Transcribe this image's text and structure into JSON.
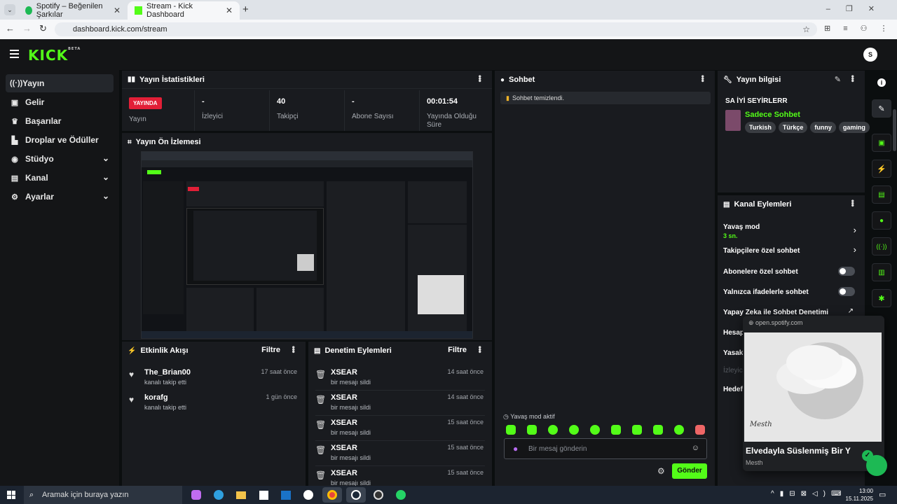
{
  "browser": {
    "tabs": [
      {
        "title": "Spotify – Beğenilen Şarkılar"
      },
      {
        "title": "Stream - Kick Dashboard"
      }
    ],
    "url": "dashboard.kick.com/stream"
  },
  "app": {
    "logo": "KICK",
    "logo_sup": "BETA",
    "avatar_initials": "S"
  },
  "sidebar": {
    "items": [
      {
        "label": "Yayın"
      },
      {
        "label": "Gelir"
      },
      {
        "label": "Başarılar"
      },
      {
        "label": "Droplar ve Ödüller"
      },
      {
        "label": "Stüdyo"
      },
      {
        "label": "Kanal"
      },
      {
        "label": "Ayarlar"
      }
    ]
  },
  "stats": {
    "title": "Yayın İstatistikleri",
    "live_badge": "YAYINDA",
    "items": [
      {
        "value": "",
        "label": "Yayın"
      },
      {
        "value": "-",
        "label": "İzleyici"
      },
      {
        "value": "40",
        "label": "Takipçi"
      },
      {
        "value": "-",
        "label": "Abone Sayısı"
      },
      {
        "value": "00:01:54",
        "label": "Yayında Olduğu Süre"
      }
    ]
  },
  "preview": {
    "title": "Yayın Ön İzlemesi"
  },
  "activity": {
    "title": "Etkinlik Akışı",
    "filter": "Filtre",
    "rows": [
      {
        "name": "The_Brian00",
        "sub": "kanalı takip etti",
        "time": "17 saat önce"
      },
      {
        "name": "korafg",
        "sub": "kanalı takip etti",
        "time": "1 gün önce"
      }
    ]
  },
  "moderation": {
    "title": "Denetim Eylemleri",
    "filter": "Filtre",
    "rows": [
      {
        "name": "XSEAR",
        "sub": "bir mesajı sildi",
        "time": "14 saat önce"
      },
      {
        "name": "XSEAR",
        "sub": "bir mesajı sildi",
        "time": "14 saat önce"
      },
      {
        "name": "XSEAR",
        "sub": "bir mesajı sildi",
        "time": "15 saat önce"
      },
      {
        "name": "XSEAR",
        "sub": "bir mesajı sildi",
        "time": "15 saat önce"
      },
      {
        "name": "XSEAR",
        "sub": "bir mesajı sildi",
        "time": "15 saat önce"
      }
    ]
  },
  "chat": {
    "title": "Sohbet",
    "cleared_msg": "Sohbet temizlendi.",
    "slow_mode": "Yavaş mod aktif",
    "placeholder": "Bir mesaj gönderin",
    "send": "Gönder"
  },
  "stream_info": {
    "title": "Yayın bilgisi",
    "stream_title": "SA İYİ SEYİRLERR",
    "category": "Sadece Sohbet",
    "tags": [
      "Turkish",
      "Türkçe",
      "funny",
      "gaming"
    ]
  },
  "channel_actions": {
    "title": "Kanal Eylemleri",
    "rows": [
      {
        "label": "Yavaş mod",
        "sub": "3 sn."
      },
      {
        "label": "Takipçilere özel sohbet"
      },
      {
        "label": "Abonelere özel sohbet"
      },
      {
        "label": "Yalnızca ifadelerle sohbet"
      },
      {
        "label": "Yapay Zeka ile Sohbet Denetimi"
      },
      {
        "label": "Hesap"
      },
      {
        "label": "Yasak"
      },
      {
        "label": "İzleyic"
      },
      {
        "label": "Hedef"
      }
    ]
  },
  "spotify_popup": {
    "domain": "open.spotify.com",
    "album_text": "Mesth",
    "song": "Elvedayla Süslenmiş Bir Y",
    "artist": "Mesth"
  },
  "taskbar": {
    "search_placeholder": "Aramak için buraya yazın",
    "time": "13:00",
    "date": "15.11.2025"
  },
  "colors": {
    "accent": "#53fc18",
    "live": "#e21f37",
    "bg": "#0b0e0f",
    "panel": "#191b1f"
  }
}
